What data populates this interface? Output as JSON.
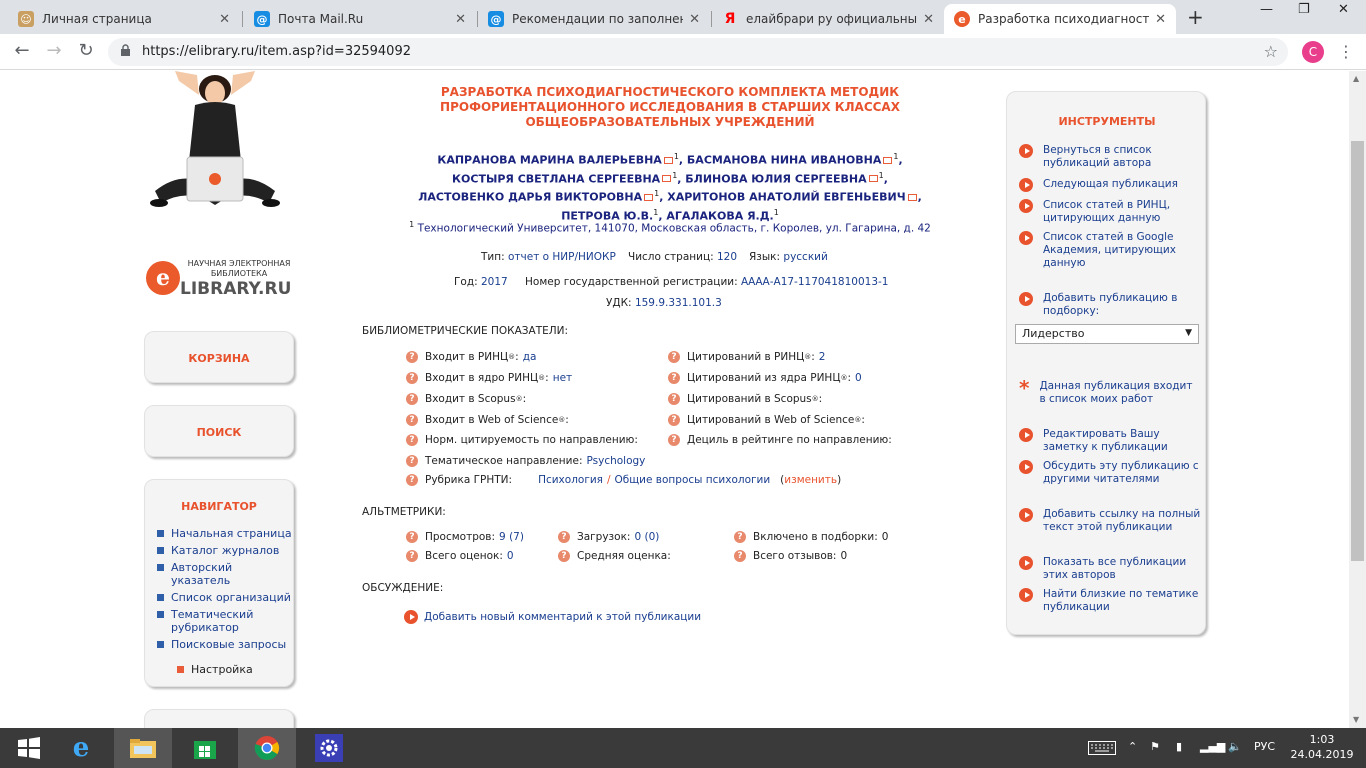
{
  "browser": {
    "tabs": [
      {
        "title": "Личная страница",
        "favicon": "person-icon",
        "color": "#c9a062"
      },
      {
        "title": "Почта Mail.Ru",
        "favicon": "at-icon",
        "color": "#168de2"
      },
      {
        "title": "Рекомендации по заполнению",
        "favicon": "at-icon",
        "color": "#168de2"
      },
      {
        "title": "елайбрари ру официальный с",
        "favicon": "yandex-icon",
        "color": "#ff0000"
      },
      {
        "title": "Разработка психодиагностиче",
        "favicon": "elibrary-icon",
        "color": "#ea5a2b"
      }
    ],
    "url": "https://elibrary.ru/item.asp?id=32594092",
    "profile_initial": "C"
  },
  "site": {
    "logo_caption": "НАУЧНАЯ ЭЛЕКТРОННАЯ БИБЛИОТЕКА",
    "logo_letter": "e",
    "logo_name": "LIBRARY.RU",
    "cart_label": "КОРЗИНА",
    "search_label": "ПОИСК",
    "navigator_title": "НАВИГАТОР",
    "nav_items": [
      "Начальная страница",
      "Каталог журналов",
      "Авторский указатель",
      "Список организаций",
      "Тематический рубрикатор",
      "Поисковые запросы"
    ],
    "settings_label": "Настройка"
  },
  "publication": {
    "title": "РАЗРАБОТКА ПСИХОДИАГНОСТИЧЕСКОГО КОМПЛЕКТА МЕТОДИК ПРОФОРИЕНТАЦИОННОГО ИССЛЕДОВАНИЯ В СТАРШИХ КЛАССАХ ОБЩЕОБРАЗОВАТЕЛЬНЫХ УЧРЕЖДЕНИЙ",
    "authors": [
      "КАПРАНОВА МАРИНА ВАЛЕРЬЕВНА",
      "БАСМАНОВА НИНА ИВАНОВНА",
      "КОСТЫРЯ СВЕТЛАНА СЕРГЕЕВНА",
      "БЛИНОВА ЮЛИЯ СЕРГЕЕВНА",
      "ЛАСТОВЕНКО ДАРЬЯ ВИКТОРОВНА",
      "ХАРИТОНОВ АНАТОЛИЙ ЕВГЕНЬЕВИЧ",
      "ПЕТРОВА Ю.В.",
      "АГАЛАКОВА Я.Д."
    ],
    "affiliation_mark": "1",
    "affiliation": "Технологический Университет, 141070, Московская область, г. Королев, ул. Гагарина, д. 42",
    "type_label": "Тип:",
    "type_value": "отчет о НИР/НИОКР",
    "pages_label": "Число страниц:",
    "pages_value": "120",
    "lang_label": "Язык:",
    "lang_value": "русский",
    "year_label": "Год:",
    "year_value": "2017",
    "reg_label": "Номер государственной регистрации:",
    "reg_value": "АААА-А17-117041810013-1",
    "udc_label": "УДК:",
    "udc_value": "159.9.331.101.3"
  },
  "biblio": {
    "title": "БИБЛИОМЕТРИЧЕСКИЕ ПОКАЗАТЕЛИ:",
    "left": [
      {
        "label": "Входит в РИНЦ",
        "reg": "®",
        "value": "да"
      },
      {
        "label": "Входит в ядро РИНЦ",
        "reg": "®",
        "value": "нет"
      },
      {
        "label": "Входит в Scopus",
        "reg": "®",
        "value": ""
      },
      {
        "label": "Входит в Web of Science",
        "reg": "®",
        "value": ""
      },
      {
        "label": "Норм. цитируемость по направлению:",
        "reg": "",
        "value": ""
      },
      {
        "label": "Тематическое направление:",
        "reg": "",
        "value": "Psychology"
      },
      {
        "label": "Рубрика ГРНТИ:",
        "reg": "",
        "value": ""
      }
    ],
    "right": [
      {
        "label": "Цитирований в РИНЦ",
        "reg": "®",
        "value": "2"
      },
      {
        "label": "Цитирований из ядра РИНЦ",
        "reg": "®",
        "value": "0"
      },
      {
        "label": "Цитирований в Scopus",
        "reg": "®",
        "value": ""
      },
      {
        "label": "Цитирований в Web of Science",
        "reg": "®",
        "value": ""
      },
      {
        "label": "Дециль в рейтинге по направлению:",
        "reg": "",
        "value": ""
      }
    ],
    "grnti_a": "Психология",
    "grnti_sep": "/",
    "grnti_b": "Общие вопросы психологии",
    "grnti_change": "изменить"
  },
  "altmetrics": {
    "title": "АЛЬТМЕТРИКИ:",
    "items": [
      {
        "label": "Просмотров:",
        "value": "9 (7)"
      },
      {
        "label": "Загрузок:",
        "value": "0 (0)"
      },
      {
        "label": "Включено в подборки:",
        "value": "0"
      },
      {
        "label": "Всего оценок:",
        "value": "0"
      },
      {
        "label": "Средняя оценка:",
        "value": ""
      },
      {
        "label": "Всего отзывов:",
        "value": "0"
      }
    ]
  },
  "discussion": {
    "title": "ОБСУЖДЕНИЕ:",
    "add_comment": "Добавить новый комментарий к этой публикации"
  },
  "tools": {
    "title": "ИНСТРУМЕНТЫ",
    "items": [
      "Вернуться в список публикаций автора",
      "Следующая публикация",
      "Список статей в РИНЦ, цитирующих данную",
      "Список статей в Google Академия, цитирующих данную",
      "Добавить публикацию в подборку:",
      "Данная публикация входит в список моих работ",
      "Редактировать Вашу заметку к публикации",
      "Обсудить эту публикацию с другими читателями",
      "Добавить ссылку на полный текст этой публикации",
      "Показать все публикации этих авторов",
      "Найти близкие по тематике публикации"
    ],
    "collection_selected": "Лидерство"
  },
  "taskbar": {
    "lang": "РУС",
    "time": "1:03",
    "date": "24.04.2019"
  }
}
